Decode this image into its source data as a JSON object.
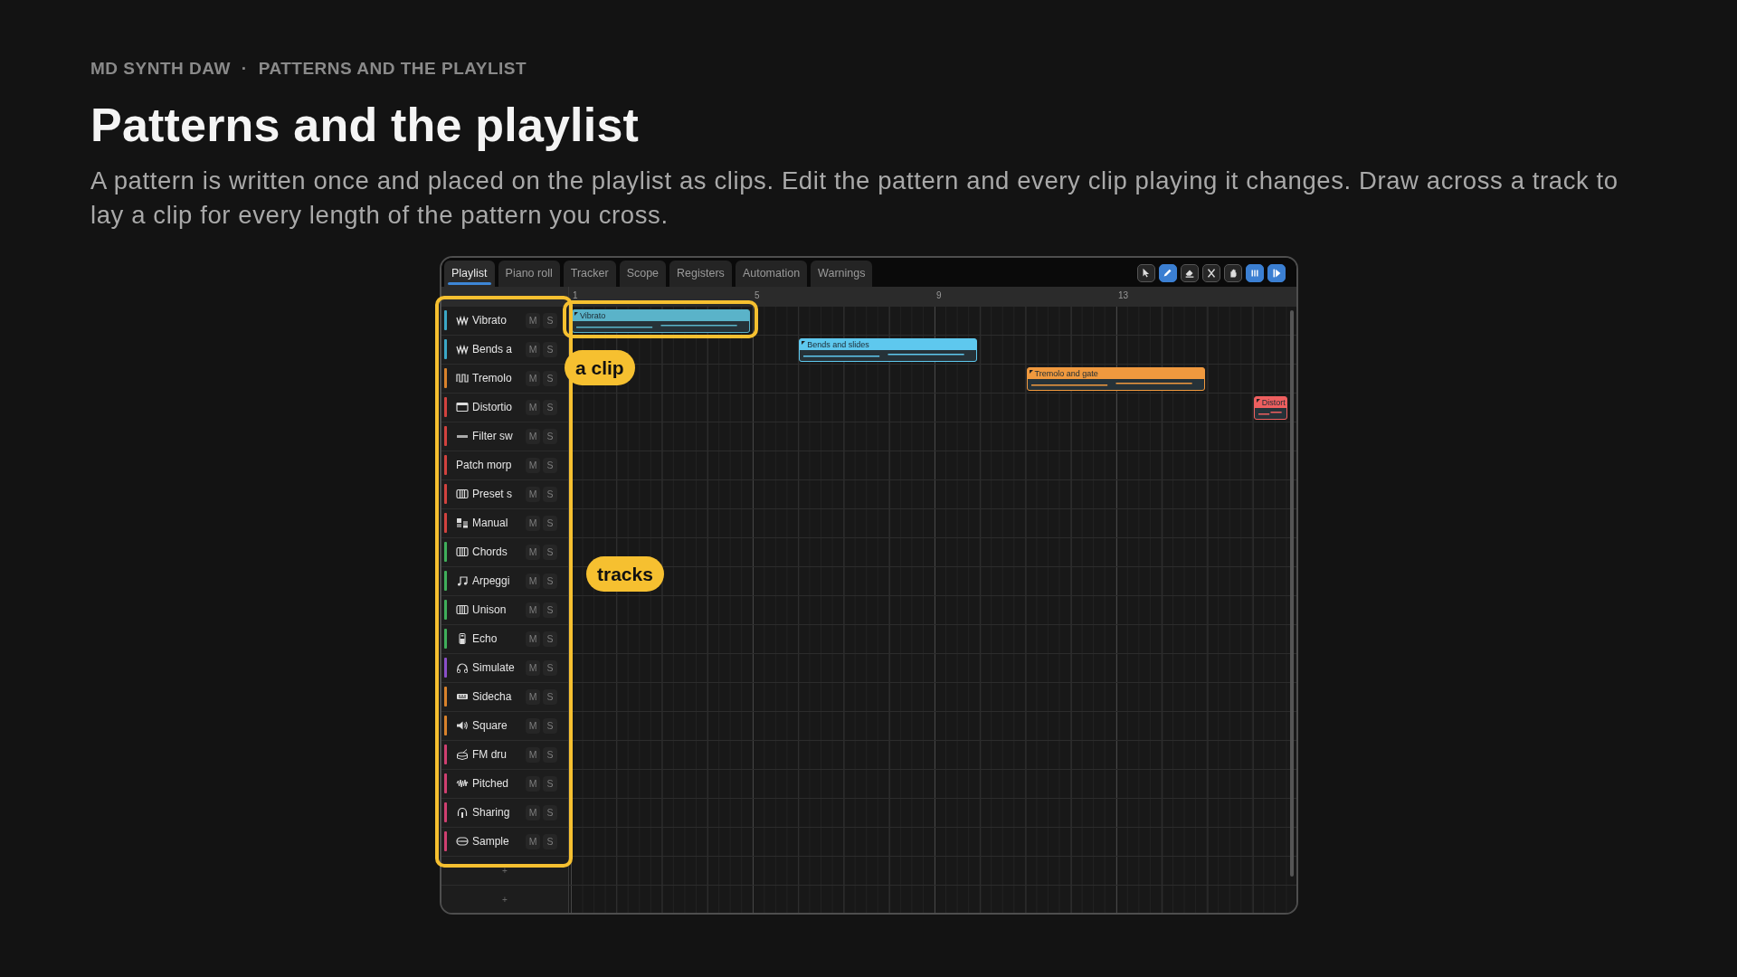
{
  "header": {
    "eyebrow": [
      "MD SYNTH DAW",
      "·",
      "PATTERNS AND THE PLAYLIST"
    ],
    "title": "Patterns and the playlist",
    "description": "A pattern is written once and placed on the playlist as clips. Edit the pattern and every clip playing it changes. Draw across a track to lay a clip for every length of the pattern you cross."
  },
  "tabs": [
    {
      "label": "Playlist",
      "selected": true
    },
    {
      "label": "Piano roll",
      "selected": false
    },
    {
      "label": "Tracker",
      "selected": false
    },
    {
      "label": "Scope",
      "selected": false
    },
    {
      "label": "Registers",
      "selected": false
    },
    {
      "label": "Automation",
      "selected": false
    },
    {
      "label": "Warnings",
      "selected": false
    }
  ],
  "toolbar": [
    {
      "kind": "pointer",
      "active": false
    },
    {
      "kind": "pencil",
      "active": true
    },
    {
      "kind": "eraser",
      "active": false
    },
    {
      "kind": "cut",
      "active": false
    },
    {
      "kind": "hand",
      "active": false
    },
    {
      "kind": "pause",
      "active": true
    },
    {
      "kind": "step",
      "active": true
    }
  ],
  "ruler": [
    "1",
    "5",
    "9",
    "13"
  ],
  "tracks": [
    {
      "name": "Vibrato",
      "kind": "wave",
      "color": "#3ba7c6",
      "mute_label": "M",
      "solo_label": "S",
      "muted": false,
      "soloed": false,
      "clip": {
        "label": "Vibrato",
        "color": "#5ab3c9"
      }
    },
    {
      "name": "Bends a",
      "kind": "wave",
      "color": "#3ba7c6",
      "mute_label": "M",
      "solo_label": "S",
      "muted": false,
      "soloed": false,
      "clip": {
        "label": "Bends and slides",
        "color": "#5ec8ee"
      }
    },
    {
      "name": "Tremolo",
      "kind": "square-wave",
      "color": "#d9822b",
      "mute_label": "M",
      "solo_label": "S",
      "muted": false,
      "soloed": false,
      "clip": {
        "label": "Tremolo and gate",
        "color": "#f0993e"
      }
    },
    {
      "name": "Distortio",
      "kind": "window",
      "color": "#d2423e",
      "mute_label": "M",
      "solo_label": "S",
      "muted": false,
      "soloed": false,
      "clip": {
        "label": "Distort",
        "color": "#ee5f5f"
      }
    },
    {
      "name": "Filter sw",
      "kind": "bar",
      "color": "#d2423e",
      "mute_label": "M",
      "solo_label": "S",
      "muted": false,
      "soloed": false
    },
    {
      "name": "Patch morp",
      "color": "#d2423e",
      "mute_label": "M",
      "solo_label": "S",
      "muted": false,
      "soloed": false
    },
    {
      "name": "Preset s",
      "kind": "keys",
      "color": "#d2423e",
      "mute_label": "M",
      "solo_label": "S",
      "muted": false,
      "soloed": false
    },
    {
      "name": "Manual",
      "kind": "mixer",
      "color": "#d2423e",
      "mute_label": "M",
      "solo_label": "S",
      "muted": false,
      "soloed": false
    },
    {
      "name": "Chords",
      "kind": "keys",
      "color": "#3fae5a",
      "mute_label": "M",
      "solo_label": "S",
      "muted": false,
      "soloed": false
    },
    {
      "name": "Arpeggi",
      "kind": "note",
      "color": "#3fae5a",
      "mute_label": "M",
      "solo_label": "S",
      "muted": false,
      "soloed": false
    },
    {
      "name": "Unison",
      "kind": "keys",
      "color": "#3fae5a",
      "mute_label": "M",
      "solo_label": "S",
      "muted": false,
      "soloed": false
    },
    {
      "name": "Echo",
      "kind": "pedal",
      "color": "#3fae5a",
      "mute_label": "M",
      "solo_label": "S",
      "muted": false,
      "soloed": false
    },
    {
      "name": "Simulate",
      "kind": "headphones",
      "color": "#8a4fc8",
      "mute_label": "M",
      "solo_label": "S",
      "muted": false,
      "soloed": false
    },
    {
      "name": "Sidecha",
      "kind": "keyboard",
      "color": "#d9822b",
      "mute_label": "M",
      "solo_label": "S",
      "muted": false,
      "soloed": false
    },
    {
      "name": "Square",
      "kind": "speaker",
      "color": "#d9822b",
      "mute_label": "M",
      "solo_label": "S",
      "muted": false,
      "soloed": false
    },
    {
      "name": "FM dru",
      "kind": "drum",
      "color": "#cf3f70",
      "mute_label": "M",
      "solo_label": "S",
      "muted": false,
      "soloed": false
    },
    {
      "name": "Pitched",
      "kind": "noise",
      "color": "#cf3f70",
      "mute_label": "M",
      "solo_label": "S",
      "muted": false,
      "soloed": false
    },
    {
      "name": "Sharing",
      "kind": "headset",
      "color": "#cf3f70",
      "mute_label": "M",
      "solo_label": "S",
      "muted": false,
      "soloed": false
    },
    {
      "name": "Sample",
      "kind": "disk",
      "color": "#cf3f70",
      "mute_label": "M",
      "solo_label": "S",
      "muted": false,
      "soloed": false
    }
  ],
  "add_rows": [
    "+",
    "+"
  ],
  "annotations": [
    {
      "label": "a clip",
      "kind": "clip"
    },
    {
      "label": "tracks",
      "kind": "tracks"
    }
  ]
}
